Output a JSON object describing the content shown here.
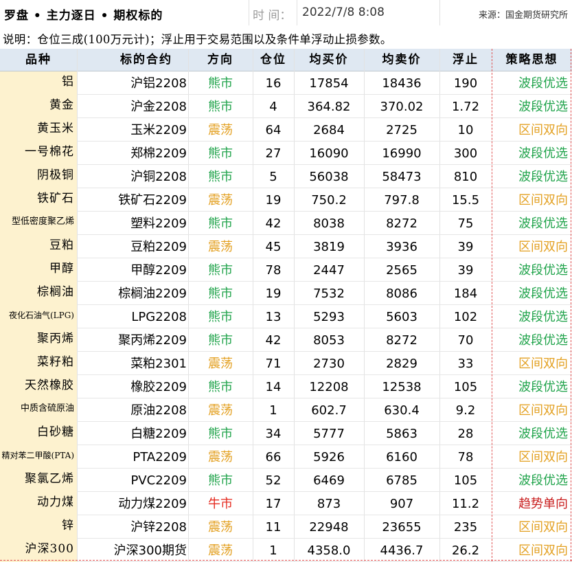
{
  "header": {
    "title": "罗盘 • 主力逐日 • 期权标的",
    "time_label": "时 间：",
    "time_value": "2022/7/8 8:08",
    "source": "来源：国金期货研究所"
  },
  "note": "说明：仓位三成(100万元计)；浮止用于交易范围以及条件单浮动止损参数。",
  "columns": [
    "品种",
    "标的合约",
    "方向",
    "仓位",
    "均买价",
    "均卖价",
    "浮止",
    "策略思想"
  ],
  "colors": {
    "bear": "#1fa34a",
    "oscillate": "#e3a021",
    "bull": "#e52a1f",
    "name_bg": "#fdf2cf",
    "header_bg": "#dfe8f2"
  },
  "rows": [
    {
      "name": "铝",
      "contract": "沪铝2208",
      "direction": "熊市",
      "position": "16",
      "avg_buy": "17854",
      "avg_sell": "18436",
      "float_stop": "190",
      "strategy": "波段优选"
    },
    {
      "name": "黄金",
      "contract": "沪金2208",
      "direction": "熊市",
      "position": "4",
      "avg_buy": "364.82",
      "avg_sell": "370.02",
      "float_stop": "1.72",
      "strategy": "波段优选"
    },
    {
      "name": "黄玉米",
      "contract": "玉米2209",
      "direction": "震荡",
      "position": "64",
      "avg_buy": "2684",
      "avg_sell": "2725",
      "float_stop": "10",
      "strategy": "区间双向"
    },
    {
      "name": "一号棉花",
      "contract": "郑棉2209",
      "direction": "熊市",
      "position": "27",
      "avg_buy": "16090",
      "avg_sell": "16990",
      "float_stop": "300",
      "strategy": "波段优选"
    },
    {
      "name": "阴极铜",
      "contract": "沪铜2208",
      "direction": "熊市",
      "position": "5",
      "avg_buy": "56038",
      "avg_sell": "58473",
      "float_stop": "810",
      "strategy": "波段优选"
    },
    {
      "name": "铁矿石",
      "contract": "铁矿石2209",
      "direction": "震荡",
      "position": "19",
      "avg_buy": "750.2",
      "avg_sell": "797.8",
      "float_stop": "15.5",
      "strategy": "区间双向"
    },
    {
      "name": "型低密度聚乙烯",
      "contract": "塑料2209",
      "direction": "熊市",
      "position": "42",
      "avg_buy": "8038",
      "avg_sell": "8272",
      "float_stop": "75",
      "strategy": "波段优选"
    },
    {
      "name": "豆粕",
      "contract": "豆粕2209",
      "direction": "震荡",
      "position": "45",
      "avg_buy": "3819",
      "avg_sell": "3936",
      "float_stop": "39",
      "strategy": "区间双向"
    },
    {
      "name": "甲醇",
      "contract": "甲醇2209",
      "direction": "熊市",
      "position": "78",
      "avg_buy": "2447",
      "avg_sell": "2565",
      "float_stop": "39",
      "strategy": "波段优选"
    },
    {
      "name": "棕榈油",
      "contract": "棕榈油2209",
      "direction": "熊市",
      "position": "19",
      "avg_buy": "7532",
      "avg_sell": "8086",
      "float_stop": "184",
      "strategy": "波段优选"
    },
    {
      "name": "夜化石油气(LPG)",
      "contract": "LPG2208",
      "direction": "熊市",
      "position": "13",
      "avg_buy": "5293",
      "avg_sell": "5603",
      "float_stop": "102",
      "strategy": "波段优选"
    },
    {
      "name": "聚丙烯",
      "contract": "聚丙烯2209",
      "direction": "熊市",
      "position": "42",
      "avg_buy": "8053",
      "avg_sell": "8272",
      "float_stop": "70",
      "strategy": "波段优选"
    },
    {
      "name": "菜籽粕",
      "contract": "菜粕2301",
      "direction": "震荡",
      "position": "71",
      "avg_buy": "2730",
      "avg_sell": "2829",
      "float_stop": "33",
      "strategy": "区间双向"
    },
    {
      "name": "天然橡胶",
      "contract": "橡胶2209",
      "direction": "熊市",
      "position": "14",
      "avg_buy": "12208",
      "avg_sell": "12538",
      "float_stop": "105",
      "strategy": "波段优选"
    },
    {
      "name": "中质含硫原油",
      "contract": "原油2208",
      "direction": "震荡",
      "position": "1",
      "avg_buy": "602.7",
      "avg_sell": "630.4",
      "float_stop": "9.2",
      "strategy": "区间双向"
    },
    {
      "name": "白砂糖",
      "contract": "白糖2209",
      "direction": "熊市",
      "position": "34",
      "avg_buy": "5777",
      "avg_sell": "5863",
      "float_stop": "28",
      "strategy": "波段优选"
    },
    {
      "name": "精对苯二甲酸(PTA)",
      "contract": "PTA2209",
      "direction": "震荡",
      "position": "66",
      "avg_buy": "5926",
      "avg_sell": "6160",
      "float_stop": "78",
      "strategy": "区间双向"
    },
    {
      "name": "聚氯乙烯",
      "contract": "PVC2209",
      "direction": "熊市",
      "position": "52",
      "avg_buy": "6469",
      "avg_sell": "6785",
      "float_stop": "105",
      "strategy": "波段优选"
    },
    {
      "name": "动力煤",
      "contract": "动力煤2209",
      "direction": "牛市",
      "position": "17",
      "avg_buy": "873",
      "avg_sell": "907",
      "float_stop": "11.2",
      "strategy": "趋势单向"
    },
    {
      "name": "锌",
      "contract": "沪锌2208",
      "direction": "震荡",
      "position": "11",
      "avg_buy": "22948",
      "avg_sell": "23655",
      "float_stop": "235",
      "strategy": "区间双向"
    },
    {
      "name": "沪深300",
      "contract": "沪深300期货",
      "direction": "震荡",
      "position": "1",
      "avg_buy": "4358.0",
      "avg_sell": "4436.7",
      "float_stop": "26.2",
      "strategy": "区间双向"
    }
  ]
}
